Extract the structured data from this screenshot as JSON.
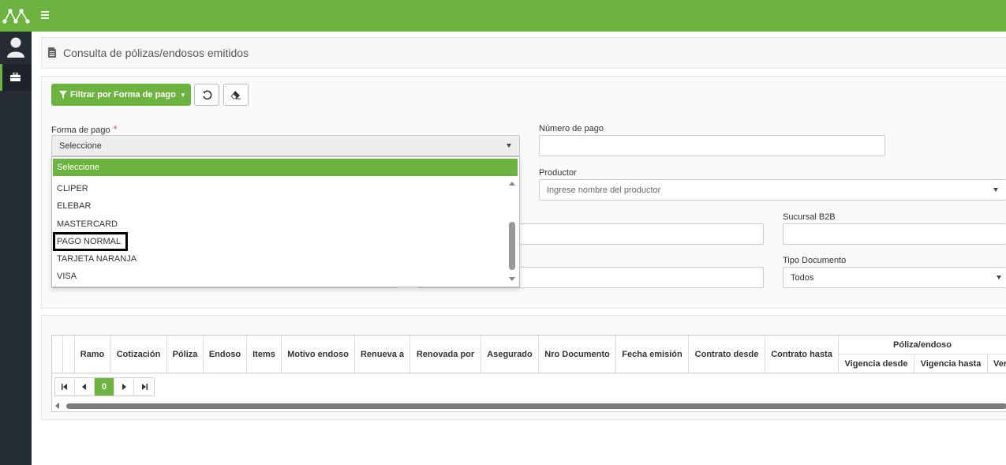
{
  "header": {
    "menu_icon": "hamburger-icon",
    "logo_icon": "logo-icon"
  },
  "sidebar": {
    "items": [
      {
        "icon": "user-icon"
      },
      {
        "icon": "briefcase-icon"
      }
    ]
  },
  "page": {
    "title": "Consulta de pólizas/endosos emitidos",
    "title_icon": "document-icon"
  },
  "toolbar": {
    "filter_label": "Filtrar por Forma de pago",
    "filter_icon": "filter-icon",
    "reset_icon": "undo-icon",
    "clear_icon": "eraser-icon"
  },
  "form": {
    "forma_pago": {
      "label": "Forma de pago",
      "required_mark": "*",
      "value": "Seleccione"
    },
    "numero_pago": {
      "label": "Número de pago",
      "value": ""
    },
    "productor": {
      "label": "Productor",
      "placeholder": "Ingrese nombre del productor"
    },
    "sucursal_b2b": {
      "label": "Sucursal B2B",
      "value": ""
    },
    "tipo_documento": {
      "label": "Tipo Documento",
      "value": "Todos"
    }
  },
  "dropdown": {
    "selected": "Seleccione",
    "options": [
      "CLIPER",
      "ELEBAR",
      "MASTERCARD",
      "PAGO NORMAL",
      "TARJETA NARANJA",
      "VISA"
    ],
    "highlighted": "PAGO NORMAL"
  },
  "table": {
    "columns": [
      "Ramo",
      "Cotización",
      "Póliza",
      "Endoso",
      "Items",
      "Motivo endoso",
      "Renueva a",
      "Renovada por",
      "Asegurado",
      "Nro Documento",
      "Fecha emisión",
      "Contrato desde",
      "Contrato hasta"
    ],
    "group_header": "Póliza/endoso",
    "group_columns": [
      "Vigencia desde",
      "Vigencia hasta",
      "Ver"
    ],
    "pager": {
      "current_page": "0"
    }
  },
  "colors": {
    "accent": "#6db33f",
    "sidebar": "#252c33"
  }
}
